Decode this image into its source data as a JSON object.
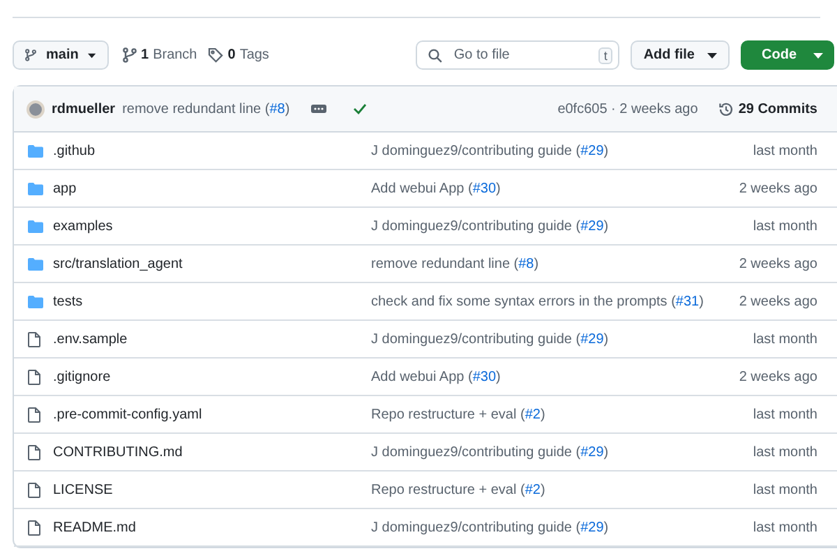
{
  "toolbar": {
    "branch": "main",
    "branches": {
      "count": "1",
      "label": "Branch"
    },
    "tags": {
      "count": "0",
      "label": "Tags"
    },
    "search": {
      "placeholder": "Go to file",
      "key": "t"
    },
    "add_file": "Add file",
    "code": "Code"
  },
  "latest_commit": {
    "author": "rdmueller",
    "message": {
      "text": "remove redundant line (",
      "link": "#8",
      "end": ")"
    },
    "checks_passed": true,
    "hash": "e0fc605 · 2 weeks ago",
    "commits": "29 Commits"
  },
  "files": [
    {
      "kind": "folder",
      "name": ".github",
      "message": {
        "text": "J dominguez9/contributing guide (",
        "link": "#29",
        "end": ")"
      },
      "time": "last month"
    },
    {
      "kind": "folder",
      "name": "app",
      "message": {
        "text": "Add webui App (",
        "link": "#30",
        "end": ")"
      },
      "time": "2 weeks ago"
    },
    {
      "kind": "folder",
      "name": "examples",
      "message": {
        "text": "J dominguez9/contributing guide (",
        "link": "#29",
        "end": ")"
      },
      "time": "last month"
    },
    {
      "kind": "folder",
      "name": "src/translation_agent",
      "message": {
        "text": "remove redundant line (",
        "link": "#8",
        "end": ")"
      },
      "time": "2 weeks ago"
    },
    {
      "kind": "folder",
      "name": "tests",
      "message": {
        "text": "check and fix some syntax errors in the prompts (",
        "link": "#31",
        "end": ")"
      },
      "time": "2 weeks ago"
    },
    {
      "kind": "file",
      "name": ".env.sample",
      "message": {
        "text": "J dominguez9/contributing guide (",
        "link": "#29",
        "end": ")"
      },
      "time": "last month"
    },
    {
      "kind": "file",
      "name": ".gitignore",
      "message": {
        "text": "Add webui App (",
        "link": "#30",
        "end": ")"
      },
      "time": "2 weeks ago"
    },
    {
      "kind": "file",
      "name": ".pre-commit-config.yaml",
      "message": {
        "text": "Repo restructure + eval (",
        "link": "#2",
        "end": ")"
      },
      "time": "last month"
    },
    {
      "kind": "file",
      "name": "CONTRIBUTING.md",
      "message": {
        "text": "J dominguez9/contributing guide (",
        "link": "#29",
        "end": ")"
      },
      "time": "last month"
    },
    {
      "kind": "file",
      "name": "LICENSE",
      "message": {
        "text": "Repo restructure + eval (",
        "link": "#2",
        "end": ")"
      },
      "time": "last month"
    },
    {
      "kind": "file",
      "name": "README.md",
      "message": {
        "text": "J dominguez9/contributing guide (",
        "link": "#29",
        "end": ")"
      },
      "time": "last month"
    }
  ]
}
